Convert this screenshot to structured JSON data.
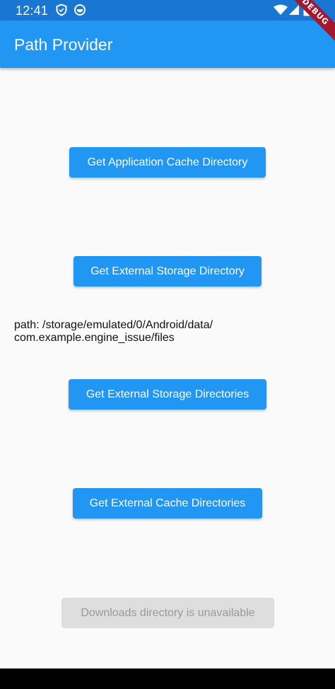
{
  "status_bar": {
    "time": "12:41",
    "left_icons": [
      "shield-icon",
      "circle-face-icon"
    ],
    "right_icons": [
      "wifi-icon",
      "signal-icon",
      "battery-icon"
    ],
    "background": "#1976d2"
  },
  "debug_banner": {
    "label": "DEBUG"
  },
  "app_bar": {
    "title": "Path Provider",
    "background": "#2196f3"
  },
  "buttons": {
    "app_cache": "Get Application Cache Directory",
    "external_storage": "Get External Storage Directory",
    "external_storage_dirs": "Get External Storage Directories",
    "external_cache_dirs": "Get External Cache Directories",
    "downloads": "Downloads directory is unavailable"
  },
  "result": {
    "path_line_1": "path: /storage/emulated/0/Android/data/",
    "path_line_2": "com.example.engine_issue/files"
  },
  "colors": {
    "primary": "#2196f3",
    "disabled_bg": "#dedede",
    "disabled_text": "#9a9a9a",
    "page_bg": "#fafafa"
  }
}
